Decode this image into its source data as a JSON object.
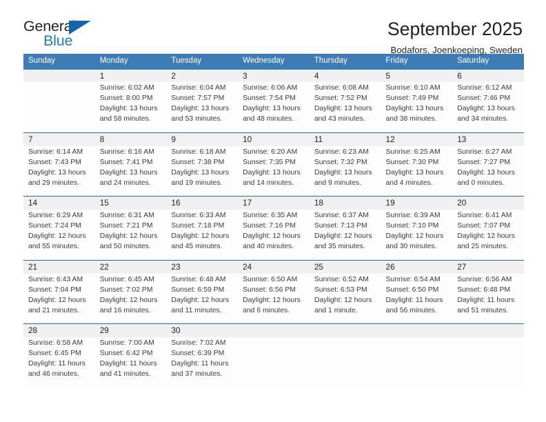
{
  "brand": {
    "name_part1": "General",
    "name_part2": "Blue",
    "triangle_icon": "triangle-icon",
    "color_dark": "#231f20",
    "color_blue": "#1f7ac0"
  },
  "header": {
    "title": "September 2025",
    "subtitle": "Bodafors, Joenkoeping, Sweden"
  },
  "theme": {
    "header_bg": "#3d7cb5",
    "header_text": "#ffffff",
    "daynum_bg": "#f0f0f0",
    "week_divider": "#2c6ca5",
    "cell_bg": "#fdfdfd"
  },
  "calendar": {
    "weekday_headers": [
      "Sunday",
      "Monday",
      "Tuesday",
      "Wednesday",
      "Thursday",
      "Friday",
      "Saturday"
    ],
    "weeks": [
      [
        {
          "day": "",
          "lines": []
        },
        {
          "day": "1",
          "lines": [
            "Sunrise: 6:02 AM",
            "Sunset: 8:00 PM",
            "Daylight: 13 hours",
            "and 58 minutes."
          ]
        },
        {
          "day": "2",
          "lines": [
            "Sunrise: 6:04 AM",
            "Sunset: 7:57 PM",
            "Daylight: 13 hours",
            "and 53 minutes."
          ]
        },
        {
          "day": "3",
          "lines": [
            "Sunrise: 6:06 AM",
            "Sunset: 7:54 PM",
            "Daylight: 13 hours",
            "and 48 minutes."
          ]
        },
        {
          "day": "4",
          "lines": [
            "Sunrise: 6:08 AM",
            "Sunset: 7:52 PM",
            "Daylight: 13 hours",
            "and 43 minutes."
          ]
        },
        {
          "day": "5",
          "lines": [
            "Sunrise: 6:10 AM",
            "Sunset: 7:49 PM",
            "Daylight: 13 hours",
            "and 38 minutes."
          ]
        },
        {
          "day": "6",
          "lines": [
            "Sunrise: 6:12 AM",
            "Sunset: 7:46 PM",
            "Daylight: 13 hours",
            "and 34 minutes."
          ]
        }
      ],
      [
        {
          "day": "7",
          "lines": [
            "Sunrise: 6:14 AM",
            "Sunset: 7:43 PM",
            "Daylight: 13 hours",
            "and 29 minutes."
          ]
        },
        {
          "day": "8",
          "lines": [
            "Sunrise: 6:16 AM",
            "Sunset: 7:41 PM",
            "Daylight: 13 hours",
            "and 24 minutes."
          ]
        },
        {
          "day": "9",
          "lines": [
            "Sunrise: 6:18 AM",
            "Sunset: 7:38 PM",
            "Daylight: 13 hours",
            "and 19 minutes."
          ]
        },
        {
          "day": "10",
          "lines": [
            "Sunrise: 6:20 AM",
            "Sunset: 7:35 PM",
            "Daylight: 13 hours",
            "and 14 minutes."
          ]
        },
        {
          "day": "11",
          "lines": [
            "Sunrise: 6:23 AM",
            "Sunset: 7:32 PM",
            "Daylight: 13 hours",
            "and 9 minutes."
          ]
        },
        {
          "day": "12",
          "lines": [
            "Sunrise: 6:25 AM",
            "Sunset: 7:30 PM",
            "Daylight: 13 hours",
            "and 4 minutes."
          ]
        },
        {
          "day": "13",
          "lines": [
            "Sunrise: 6:27 AM",
            "Sunset: 7:27 PM",
            "Daylight: 13 hours",
            "and 0 minutes."
          ]
        }
      ],
      [
        {
          "day": "14",
          "lines": [
            "Sunrise: 6:29 AM",
            "Sunset: 7:24 PM",
            "Daylight: 12 hours",
            "and 55 minutes."
          ]
        },
        {
          "day": "15",
          "lines": [
            "Sunrise: 6:31 AM",
            "Sunset: 7:21 PM",
            "Daylight: 12 hours",
            "and 50 minutes."
          ]
        },
        {
          "day": "16",
          "lines": [
            "Sunrise: 6:33 AM",
            "Sunset: 7:18 PM",
            "Daylight: 12 hours",
            "and 45 minutes."
          ]
        },
        {
          "day": "17",
          "lines": [
            "Sunrise: 6:35 AM",
            "Sunset: 7:16 PM",
            "Daylight: 12 hours",
            "and 40 minutes."
          ]
        },
        {
          "day": "18",
          "lines": [
            "Sunrise: 6:37 AM",
            "Sunset: 7:13 PM",
            "Daylight: 12 hours",
            "and 35 minutes."
          ]
        },
        {
          "day": "19",
          "lines": [
            "Sunrise: 6:39 AM",
            "Sunset: 7:10 PM",
            "Daylight: 12 hours",
            "and 30 minutes."
          ]
        },
        {
          "day": "20",
          "lines": [
            "Sunrise: 6:41 AM",
            "Sunset: 7:07 PM",
            "Daylight: 12 hours",
            "and 25 minutes."
          ]
        }
      ],
      [
        {
          "day": "21",
          "lines": [
            "Sunrise: 6:43 AM",
            "Sunset: 7:04 PM",
            "Daylight: 12 hours",
            "and 21 minutes."
          ]
        },
        {
          "day": "22",
          "lines": [
            "Sunrise: 6:45 AM",
            "Sunset: 7:02 PM",
            "Daylight: 12 hours",
            "and 16 minutes."
          ]
        },
        {
          "day": "23",
          "lines": [
            "Sunrise: 6:48 AM",
            "Sunset: 6:59 PM",
            "Daylight: 12 hours",
            "and 11 minutes."
          ]
        },
        {
          "day": "24",
          "lines": [
            "Sunrise: 6:50 AM",
            "Sunset: 6:56 PM",
            "Daylight: 12 hours",
            "and 6 minutes."
          ]
        },
        {
          "day": "25",
          "lines": [
            "Sunrise: 6:52 AM",
            "Sunset: 6:53 PM",
            "Daylight: 12 hours",
            "and 1 minute."
          ]
        },
        {
          "day": "26",
          "lines": [
            "Sunrise: 6:54 AM",
            "Sunset: 6:50 PM",
            "Daylight: 11 hours",
            "and 56 minutes."
          ]
        },
        {
          "day": "27",
          "lines": [
            "Sunrise: 6:56 AM",
            "Sunset: 6:48 PM",
            "Daylight: 11 hours",
            "and 51 minutes."
          ]
        }
      ],
      [
        {
          "day": "28",
          "lines": [
            "Sunrise: 6:58 AM",
            "Sunset: 6:45 PM",
            "Daylight: 11 hours",
            "and 46 minutes."
          ]
        },
        {
          "day": "29",
          "lines": [
            "Sunrise: 7:00 AM",
            "Sunset: 6:42 PM",
            "Daylight: 11 hours",
            "and 41 minutes."
          ]
        },
        {
          "day": "30",
          "lines": [
            "Sunrise: 7:02 AM",
            "Sunset: 6:39 PM",
            "Daylight: 11 hours",
            "and 37 minutes."
          ]
        },
        {
          "day": "",
          "lines": []
        },
        {
          "day": "",
          "lines": []
        },
        {
          "day": "",
          "lines": []
        },
        {
          "day": "",
          "lines": []
        }
      ]
    ]
  }
}
